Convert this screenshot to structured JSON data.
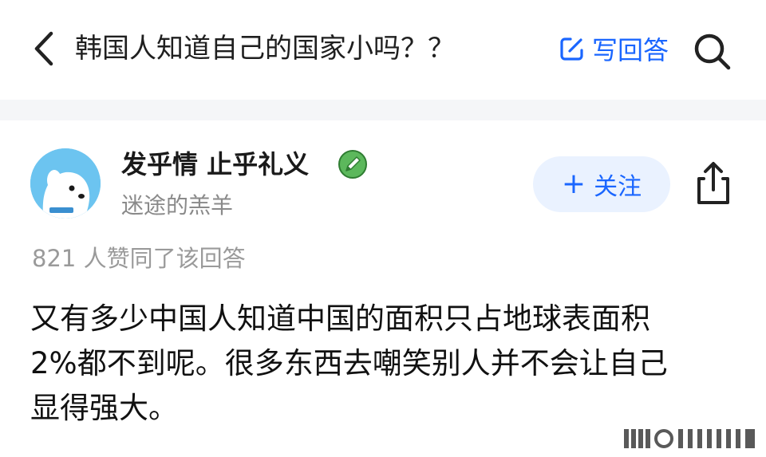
{
  "header": {
    "question_title": "韩国人知道自己的国家小吗？？",
    "write_answer_label": "写回答",
    "icons": {
      "back": "chevron-left-icon",
      "write": "edit-square-icon",
      "search": "search-icon"
    },
    "accent_color": "#1a66ff"
  },
  "answer": {
    "author": {
      "name": "发乎情 止乎礼义",
      "subtitle": "迷途的羔羊",
      "avatar": "avatar-dog-illustration",
      "badge": "verified-pen-badge",
      "badge_color": "#5cb85c"
    },
    "follow_button_label": "关注",
    "follow_plus": "+",
    "like_text": "821 人赞同了该回答",
    "body_lines": [
      "又有多少中国人知道中国的面积只占地球表面积",
      "2%都不到呢。很多东西去嘲笑别人并不会让自己",
      "显得强大。"
    ]
  }
}
